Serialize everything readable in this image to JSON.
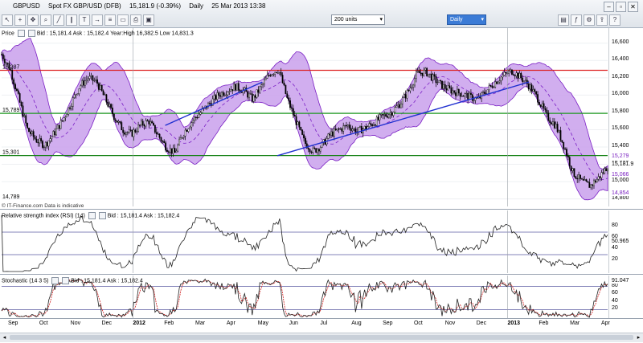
{
  "header": {
    "symbol": "GBPUSD",
    "instrument": "Spot FX GBP/USD (DFB)",
    "quote": "15,181.9 (-0.39%)",
    "timeframe": "Daily",
    "datetime": "25 Mar 2013 13:38"
  },
  "toolbar": {
    "units_value": "200 units",
    "period_value": "Daily",
    "icons": [
      "cursor-icon",
      "crosshair-icon",
      "pan-icon",
      "zoom-icon",
      "line-icon",
      "channel-icon",
      "text-icon",
      "arrow-icon",
      "fib-icon",
      "rect-icon",
      "print-icon",
      "save-icon"
    ],
    "window_buttons": [
      "minimize",
      "restore",
      "close"
    ]
  },
  "price_panel": {
    "label": "Price",
    "info": "Bid : 15,181.4  Ask : 15,182.4  Year:High 16,382.5 Low 14,831.3",
    "watermark": "© IT-Finance.com  Data is indicative",
    "ticks": [
      "16,600",
      "16,400",
      "16,200",
      "16,000",
      "15,800",
      "15,600",
      "15,400",
      "15,200",
      "15,000",
      "14,800"
    ],
    "levels": [
      {
        "label": "16,287",
        "value": 16287,
        "color": "#dd2222"
      },
      {
        "label": "15,789",
        "value": 15789,
        "color": "#1e9a1e"
      },
      {
        "label": "15,301",
        "value": 15301,
        "color": "#138013"
      },
      {
        "label": "14,789",
        "value": 14789,
        "color": "#666666"
      }
    ],
    "badges": [
      {
        "label": "15,279",
        "value": 15279,
        "color": "#7a20c0"
      },
      {
        "label": "15,181.9",
        "value": 15181.9,
        "color": "#000000"
      },
      {
        "label": "15,066",
        "value": 15066,
        "color": "#7a20c0"
      },
      {
        "label": "14,854",
        "value": 14854,
        "color": "#7a20c0"
      }
    ]
  },
  "rsi_panel": {
    "label": "Relative strength index (RSI) (14)",
    "info": "Bid : 15,181.4  Ask : 15,182.4",
    "ticks": [
      "80",
      "60",
      "40",
      "20"
    ],
    "current": "50.965",
    "upper": 70,
    "lower": 30
  },
  "stoch_panel": {
    "label": "Stochastic (14 3 5)",
    "info": "Bid : 15,181.4  Ask : 15,182.4",
    "ticks": [
      "80",
      "60",
      "40",
      "20"
    ],
    "current": "91.047",
    "upper": 80,
    "lower": 20
  },
  "x_axis": {
    "labels": [
      "Sep",
      "Oct",
      "Nov",
      "Dec",
      "2012",
      "Feb",
      "Mar",
      "Apr",
      "May",
      "Jun",
      "Jul",
      "Aug",
      "Sep",
      "Oct",
      "Nov",
      "Dec",
      "2013",
      "Feb",
      "Mar",
      "Apr"
    ],
    "bold": [
      "2012",
      "2013"
    ]
  },
  "chart_data": {
    "type": "line",
    "series_kind": "candlestick",
    "ylim": [
      14750,
      16700
    ],
    "close_series": [
      16470,
      16300,
      15950,
      15600,
      15480,
      15420,
      15550,
      15700,
      15900,
      16100,
      16200,
      16150,
      15950,
      15750,
      15600,
      15550,
      15650,
      15700,
      15550,
      15400,
      15330,
      15560,
      15700,
      15800,
      15900,
      16000,
      16050,
      16100,
      16050,
      15950,
      16100,
      16250,
      16300,
      15950,
      15700,
      15450,
      15350,
      15420,
      15550,
      15600,
      15650,
      15580,
      15620,
      15680,
      15750,
      15800,
      15900,
      16050,
      16250,
      16270,
      16180,
      16100,
      16050,
      16020,
      15980,
      15950,
      16050,
      16150,
      16230,
      16280,
      16200,
      16100,
      15950,
      15750,
      15650,
      15400,
      15100,
      15000,
      14950,
      15050,
      15180
    ],
    "levels": [
      16287,
      15789,
      15301
    ],
    "trendlines": [
      {
        "from": [
          "Jun",
          15300
        ],
        "to": [
          "Jan 2013",
          16150
        ],
        "color": "#2030d0"
      },
      {
        "from": [
          "Jan 2012",
          15650
        ],
        "to": [
          "May",
          16150
        ],
        "color": "#2030d0"
      }
    ],
    "rsi_current": 50.965,
    "stoch_current": 91.047
  }
}
